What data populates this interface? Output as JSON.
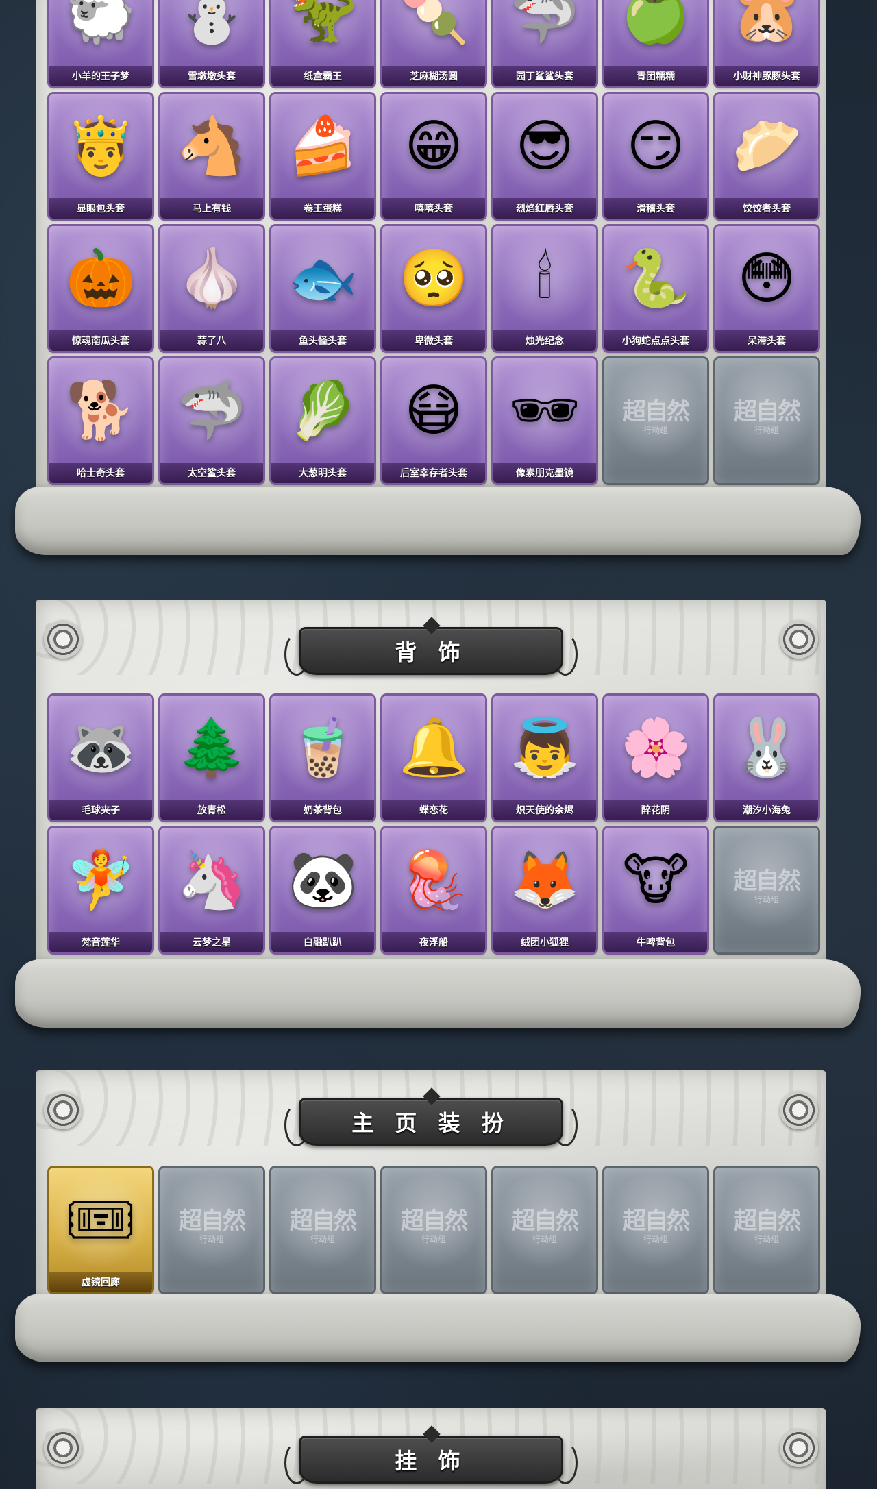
{
  "sections": {
    "heads": {
      "rows": [
        [
          {
            "label": "小羊的王子梦",
            "icon": "sheep-head-icon",
            "glyph": "🐑"
          },
          {
            "label": "雪墩墩头套",
            "icon": "snowman-head-icon",
            "glyph": "⛄"
          },
          {
            "label": "纸盒霸王",
            "icon": "cardboard-dino-icon",
            "glyph": "🦖"
          },
          {
            "label": "芝麻糊汤圆",
            "icon": "rice-ball-icon",
            "glyph": "🍡"
          },
          {
            "label": "园丁鲨鲨头套",
            "icon": "shark-head-icon",
            "glyph": "🦈"
          },
          {
            "label": "青团糯糯",
            "icon": "green-dumpling-icon",
            "glyph": "🍏"
          },
          {
            "label": "小财神豚豚头套",
            "icon": "capybara-head-icon",
            "glyph": "🐹"
          }
        ],
        [
          {
            "label": "显眼包头套",
            "icon": "crowned-bun-icon",
            "glyph": "🤴"
          },
          {
            "label": "马上有钱",
            "icon": "horse-head-icon",
            "glyph": "🐴"
          },
          {
            "label": "卷王蛋糕",
            "icon": "cake-roll-icon",
            "glyph": "🍰"
          },
          {
            "label": "嘻嘻头套",
            "icon": "grin-face-icon",
            "glyph": "😁"
          },
          {
            "label": "烈焰红唇头套",
            "icon": "pikachu-sunglasses-icon",
            "glyph": "😎"
          },
          {
            "label": "滑稽头套",
            "icon": "smirk-face-icon",
            "glyph": "😏"
          },
          {
            "label": "饺饺者头套",
            "icon": "dumpling-head-icon",
            "glyph": "🥟"
          }
        ],
        [
          {
            "label": "惊魂南瓜头套",
            "icon": "pumpkin-head-icon",
            "glyph": "🎃"
          },
          {
            "label": "蒜了八",
            "icon": "garlic-head-icon",
            "glyph": "🧄"
          },
          {
            "label": "鱼头怪头套",
            "icon": "fish-head-icon",
            "glyph": "🐟"
          },
          {
            "label": "卑微头套",
            "icon": "humble-face-icon",
            "glyph": "🥺"
          },
          {
            "label": "烛光纪念",
            "icon": "candle-head-icon",
            "glyph": "🕯"
          },
          {
            "label": "小狗蛇点点头套",
            "icon": "snake-head-icon",
            "glyph": "🐍"
          },
          {
            "label": "呆滞头套",
            "icon": "dazed-face-icon",
            "glyph": "😳"
          }
        ],
        [
          {
            "label": "哈士奇头套",
            "icon": "husky-head-icon",
            "glyph": "🐕"
          },
          {
            "label": "太空鲨头套",
            "icon": "space-shark-icon",
            "glyph": "🦈"
          },
          {
            "label": "大葱明头套",
            "icon": "scallion-head-icon",
            "glyph": "🥬"
          },
          {
            "label": "后室幸存者头套",
            "icon": "gas-mask-icon",
            "glyph": "😷"
          },
          {
            "label": "像素朋克墨镜",
            "icon": "pixel-sunglasses-icon",
            "glyph": "🕶"
          },
          {
            "label": "",
            "icon": "locked-slot-icon",
            "glyph": "",
            "locked": true
          },
          {
            "label": "",
            "icon": "locked-slot-icon",
            "glyph": "",
            "locked": true
          }
        ]
      ]
    },
    "back": {
      "title": "背 饰",
      "rows": [
        [
          {
            "label": "毛球夹子",
            "icon": "raccoon-drummer-icon",
            "glyph": "🦝"
          },
          {
            "label": "放青松",
            "icon": "bonsai-pine-icon",
            "glyph": "🌲"
          },
          {
            "label": "奶茶背包",
            "icon": "milk-tea-bag-icon",
            "glyph": "🧋"
          },
          {
            "label": "蝶恋花",
            "icon": "bell-wreath-icon",
            "glyph": "🔔"
          },
          {
            "label": "炽天使的余烬",
            "icon": "angel-doll-icon",
            "glyph": "👼"
          },
          {
            "label": "醉花阴",
            "icon": "flower-ornament-icon",
            "glyph": "🌸"
          },
          {
            "label": "潮汐小海兔",
            "icon": "sea-bunny-icon",
            "glyph": "🐰"
          }
        ],
        [
          {
            "label": "梵音莲华",
            "icon": "lotus-angel-icon",
            "glyph": "🧚"
          },
          {
            "label": "云梦之星",
            "icon": "unicorn-cloud-icon",
            "glyph": "🦄"
          },
          {
            "label": "白融趴趴",
            "icon": "panda-stick-icon",
            "glyph": "🐼"
          },
          {
            "label": "夜浮船",
            "icon": "jellyfish-icon",
            "glyph": "🪼"
          },
          {
            "label": "绒团小狐狸",
            "icon": "fox-plush-icon",
            "glyph": "🦊"
          },
          {
            "label": "牛啤背包",
            "icon": "cow-beer-icon",
            "glyph": "🐮"
          },
          {
            "label": "",
            "icon": "locked-slot-icon",
            "glyph": "",
            "locked": true
          }
        ]
      ]
    },
    "homepage": {
      "title": "主 页 装 扮",
      "rows": [
        [
          {
            "label": "虚镜回廊",
            "icon": "mirror-corridor-icon",
            "glyph": "🎟",
            "gold": true
          },
          {
            "label": "",
            "icon": "locked-slot-icon",
            "glyph": "",
            "locked": true
          },
          {
            "label": "",
            "icon": "locked-slot-icon",
            "glyph": "",
            "locked": true
          },
          {
            "label": "",
            "icon": "locked-slot-icon",
            "glyph": "",
            "locked": true
          },
          {
            "label": "",
            "icon": "locked-slot-icon",
            "glyph": "",
            "locked": true
          },
          {
            "label": "",
            "icon": "locked-slot-icon",
            "glyph": "",
            "locked": true
          },
          {
            "label": "",
            "icon": "locked-slot-icon",
            "glyph": "",
            "locked": true
          }
        ]
      ]
    },
    "pendant": {
      "title": "挂 饰"
    }
  },
  "locked_logo": {
    "main": "超自然",
    "sub": "行动组"
  },
  "colors": {
    "card_purple": "#9271bf",
    "card_gold": "#d9b248",
    "card_locked": "#7e8891",
    "banner_dark": "#2b2b2b"
  }
}
